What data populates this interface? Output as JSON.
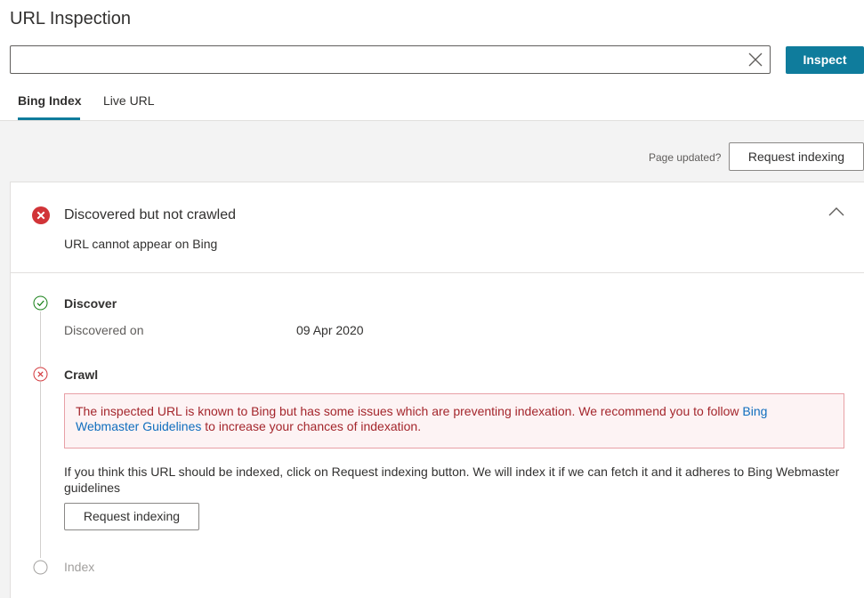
{
  "header": {
    "title": "URL Inspection",
    "url_value": "",
    "url_placeholder": "",
    "inspect_label": "Inspect"
  },
  "tabs": [
    {
      "label": "Bing Index",
      "active": true
    },
    {
      "label": "Live URL",
      "active": false
    }
  ],
  "toolbar": {
    "page_updated_label": "Page updated?",
    "request_indexing_label": "Request indexing"
  },
  "status": {
    "title": "Discovered but not crawled",
    "subtitle": "URL cannot appear on Bing",
    "icon": "error-circle-icon",
    "color": "#d13438"
  },
  "steps": {
    "discover": {
      "title": "Discover",
      "state": "success",
      "detail_label": "Discovered on",
      "detail_value": "09 Apr 2020"
    },
    "crawl": {
      "title": "Crawl",
      "state": "error",
      "error_text_before": "The inspected URL is known to Bing but has some issues which are preventing indexation. We recommend you to follow ",
      "error_link": "Bing Webmaster Guidelines",
      "error_text_after": " to increase your chances of indexation.",
      "info_text": "If you think this URL should be indexed, click on Request indexing button. We will index it if we can fetch it and it adheres to Bing Webmaster guidelines",
      "request_indexing_label": "Request indexing"
    },
    "index": {
      "title": "Index",
      "state": "pending"
    }
  },
  "colors": {
    "accent": "#0f7c9c",
    "error": "#d13438",
    "success": "#107c10",
    "link": "#106ebe"
  }
}
